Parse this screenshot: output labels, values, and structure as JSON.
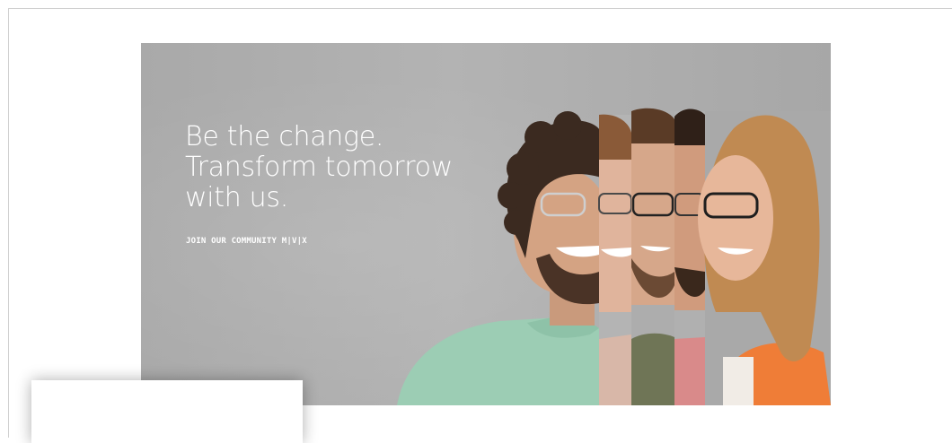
{
  "hero": {
    "headline_lines": [
      "Be the change.",
      "Transform tomorrow",
      "with us."
    ],
    "tagline": "JOIN OUR COMMUNITY M|V|X"
  },
  "colors": {
    "hero_background": "#acacac",
    "headline_text": "#ffffff",
    "sweater_mint": "#9ccdb4",
    "shirt_olive": "#6f7556",
    "jacket_orange": "#ef7d37"
  },
  "icons": {
    "portrait_collage": "portrait-collage-image"
  }
}
